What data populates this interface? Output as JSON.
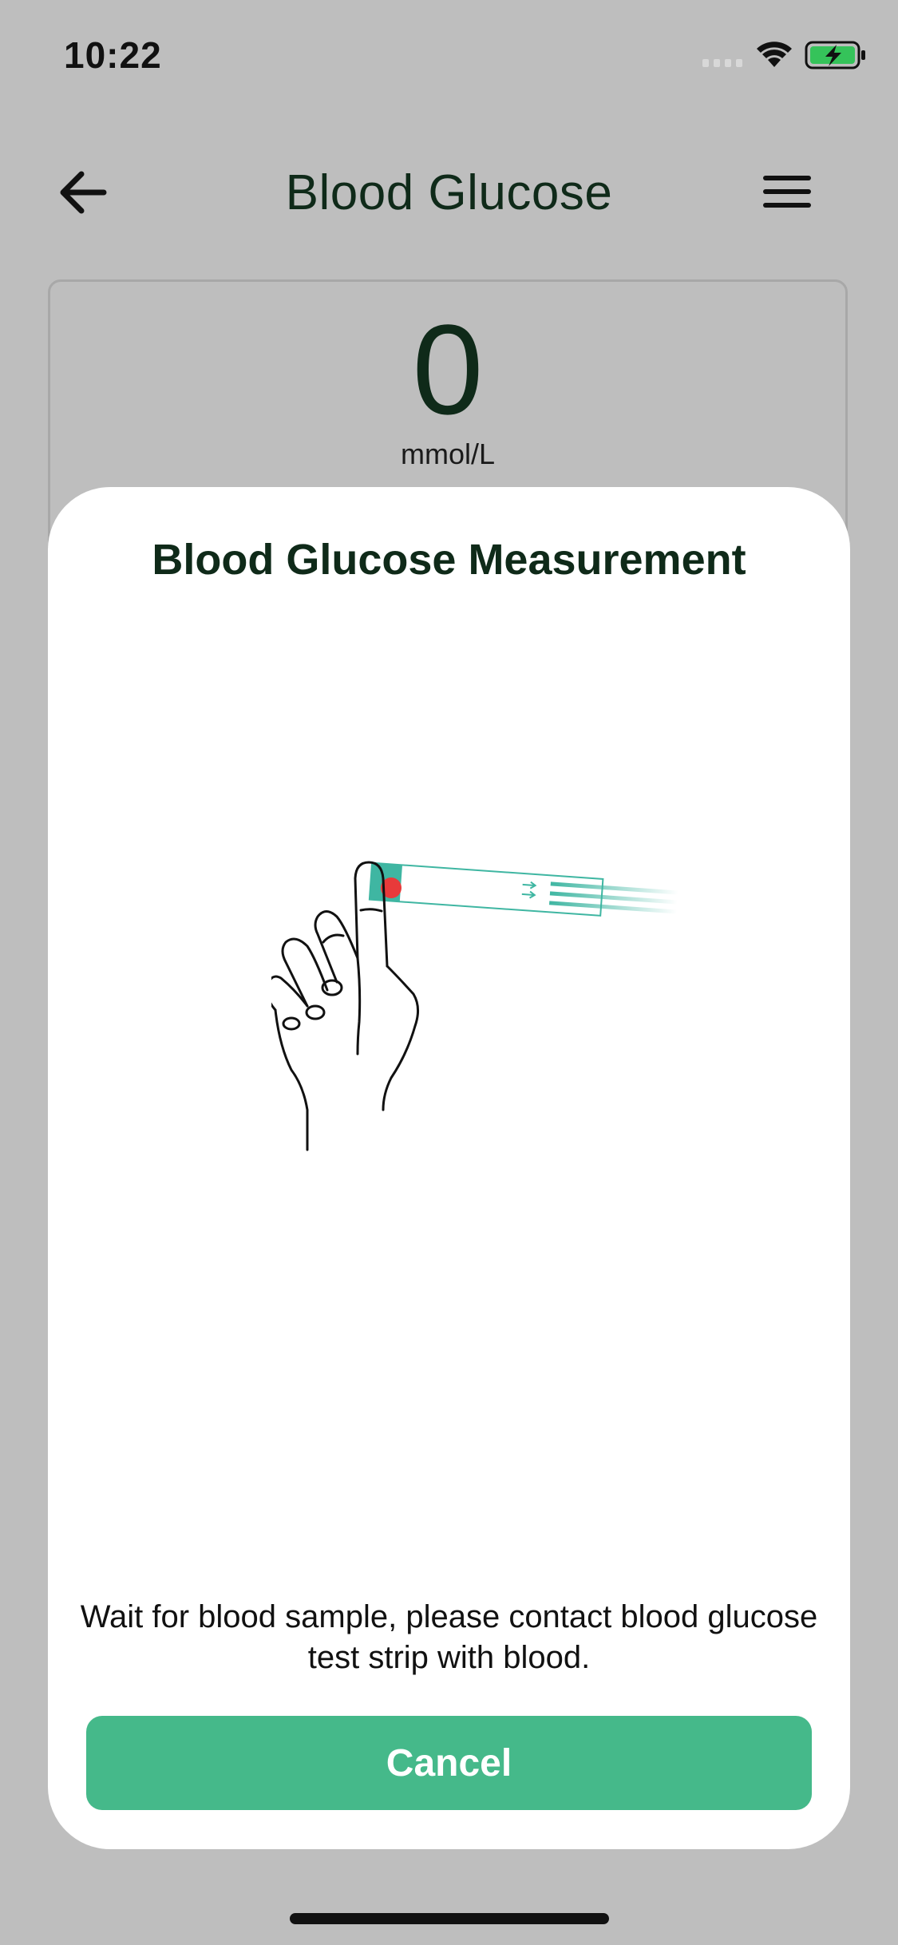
{
  "status_bar": {
    "time": "10:22",
    "icons": [
      "cellular-signal-icon",
      "wifi-icon",
      "battery-charging-icon"
    ],
    "battery_color": "#35c35a"
  },
  "header": {
    "title": "Blood Glucose",
    "back_icon": "arrow-left-icon",
    "menu_icon": "hamburger-menu-icon"
  },
  "reading": {
    "value": "0",
    "unit": "mmol/L"
  },
  "modal": {
    "title": "Blood Glucose Measurement",
    "illustration": "hand-with-test-strip",
    "message": "Wait for blood sample, please contact blood glucose test strip with blood.",
    "cancel_label": "Cancel"
  },
  "colors": {
    "accent": "#45b98a",
    "text_dark": "#0f2a19",
    "overlay_background": "#bebebe",
    "strip_teal": "#3fb6a2",
    "blood_red": "#e83a3a"
  }
}
